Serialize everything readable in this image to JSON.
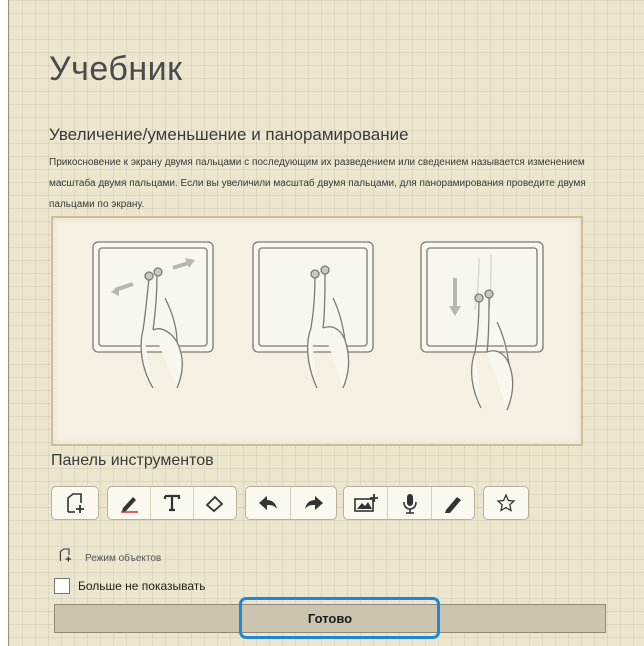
{
  "page": {
    "title": "Учебник",
    "section_title": "Увеличение/уменьшение и панорамирование",
    "description": "Прикосновение к экрану двумя пальцами с последующим их разведением или сведением называется изменением масштаба двумя пальцами. Если вы увеличили масштаб двумя пальцами, для панорамирования проведите двумя пальцами по экрану."
  },
  "illustration": {
    "panels": [
      "pinch-zoom",
      "two-finger-touch",
      "two-finger-pan"
    ]
  },
  "toolbar": {
    "title": "Панель инструментов",
    "groups": [
      {
        "tools": [
          "object-mode-icon"
        ]
      },
      {
        "tools": [
          "pen-icon",
          "text-icon",
          "eraser-icon"
        ]
      },
      {
        "tools": [
          "undo-icon",
          "redo-icon"
        ]
      },
      {
        "tools": [
          "add-image-icon",
          "microphone-icon",
          "highlighter-icon"
        ]
      },
      {
        "tools": [
          "star-icon"
        ]
      }
    ],
    "mode_label": "Режим объектов"
  },
  "footer": {
    "checkbox_label": "Больше не показывать",
    "checkbox_checked": false,
    "done_label": "Готово"
  },
  "colors": {
    "background": "#ece6cf",
    "focus_ring": "#1e88d8",
    "button": "#cbc4ae"
  }
}
